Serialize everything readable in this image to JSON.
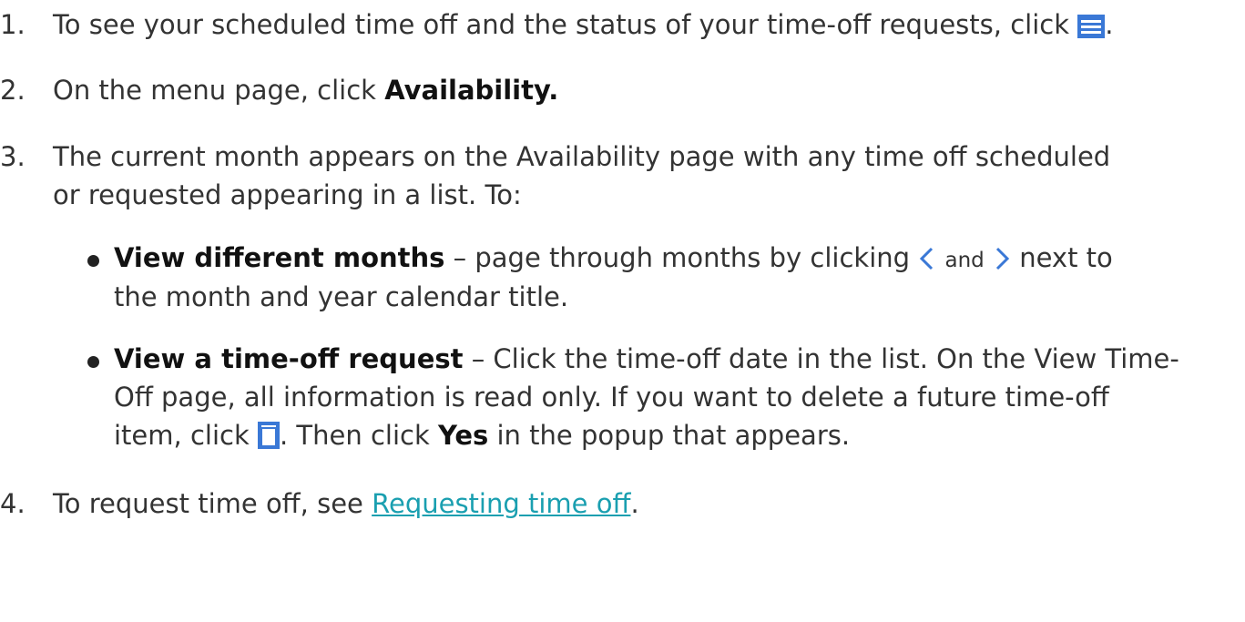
{
  "steps": [
    {
      "number": "1.",
      "text_before": "To see your scheduled time off and the status of your time-off requests, click",
      "text_after": ".",
      "icon": "hamburger-menu-icon"
    },
    {
      "number": "2.",
      "text_before": "On the menu page, click",
      "bold": "Availability."
    },
    {
      "number": "3.",
      "line1": "The current month appears on the Availability page with any time off scheduled",
      "line2": "or requested appearing in a list. To:"
    },
    {
      "number": "4.",
      "text_before": "To request time off, see",
      "link": "Requesting time off",
      "text_after": "."
    }
  ],
  "bullets": [
    {
      "bold": "View different months",
      "line1_rest": " – page through months by clicking",
      "and": "and",
      "line1_end": "next to",
      "line2": "the month and year calendar title.",
      "icons": [
        "chevron-left-icon",
        "chevron-right-icon"
      ]
    },
    {
      "bold": "View a time-off request",
      "line1_rest": " – Click the time-off date in the list. On the View Time-",
      "line2": "Off page, all information is read only. If you want to delete a future time-off",
      "line3_before": "item, click",
      "line3_mid": ". Then click",
      "line3_bold": "Yes",
      "line3_end": "in the popup that appears.",
      "icon": "trash-icon"
    }
  ],
  "colors": {
    "icon_blue": "#3a78d6",
    "link": "#1a9fb0",
    "text": "#333333"
  }
}
